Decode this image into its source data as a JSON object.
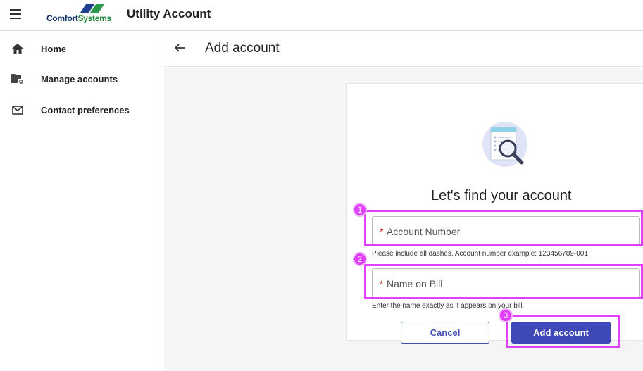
{
  "header": {
    "brand_word_a": "Comfort",
    "brand_word_b": "Systems",
    "app_title": "Utility Account"
  },
  "sidebar": {
    "items": [
      {
        "label": "Home",
        "icon": "home-icon"
      },
      {
        "label": "Manage accounts",
        "icon": "folder-gear-icon"
      },
      {
        "label": "Contact preferences",
        "icon": "mail-icon"
      }
    ]
  },
  "page": {
    "title": "Add account"
  },
  "card": {
    "heading": "Let's find your account",
    "account_number": {
      "required_marker": "*",
      "placeholder": "Account Number",
      "value": "",
      "hint": "Please include all dashes. Account number example: 123456789-001"
    },
    "name_on_bill": {
      "required_marker": "*",
      "placeholder": "Name on Bill",
      "value": "",
      "hint": "Enter the name exactly as it appears on your bill."
    },
    "cancel_label": "Cancel",
    "add_label": "Add account"
  },
  "annotations": {
    "badges": [
      "1",
      "2",
      "3"
    ],
    "color": "#e040fb"
  },
  "colors": {
    "accent": "#3f48b8",
    "required": "#c62828"
  }
}
